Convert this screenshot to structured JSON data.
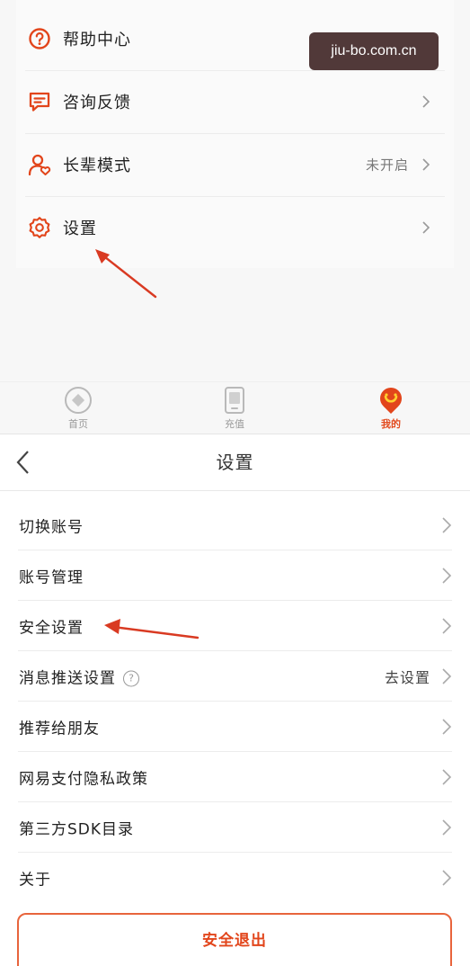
{
  "top": {
    "menu_items": [
      {
        "label": "帮助中心",
        "icon": "help-circle-icon",
        "status": ""
      },
      {
        "label": "咨询反馈",
        "icon": "feedback-message-icon",
        "status": ""
      },
      {
        "label": "长辈模式",
        "icon": "elder-mode-user-icon",
        "status": "未开启"
      },
      {
        "label": "设置",
        "icon": "settings-gear-icon",
        "status": ""
      }
    ],
    "watermark": "jiu-bo.com.cn",
    "tabs": [
      {
        "label": "首页",
        "icon": "home-diamond-icon",
        "active": false
      },
      {
        "label": "充值",
        "icon": "recharge-phone-icon",
        "active": false
      },
      {
        "label": "我的",
        "icon": "mine-mascot-icon",
        "active": true
      }
    ]
  },
  "settings": {
    "title": "设置",
    "rows": [
      {
        "label": "切换账号",
        "status": ""
      },
      {
        "label": "账号管理",
        "status": ""
      },
      {
        "label": "安全设置",
        "status": ""
      },
      {
        "label": "消息推送设置",
        "status": "去设置",
        "help": "?"
      },
      {
        "label": "推荐给朋友",
        "status": ""
      },
      {
        "label": "网易支付隐私政策",
        "status": ""
      },
      {
        "label": "第三方SDK目录",
        "status": ""
      },
      {
        "label": "关于",
        "status": ""
      }
    ],
    "logout_label": "安全退出"
  },
  "colors": {
    "accent": "#e2451b",
    "arrow": "#d93a22",
    "watermark_bg": "#422828"
  }
}
